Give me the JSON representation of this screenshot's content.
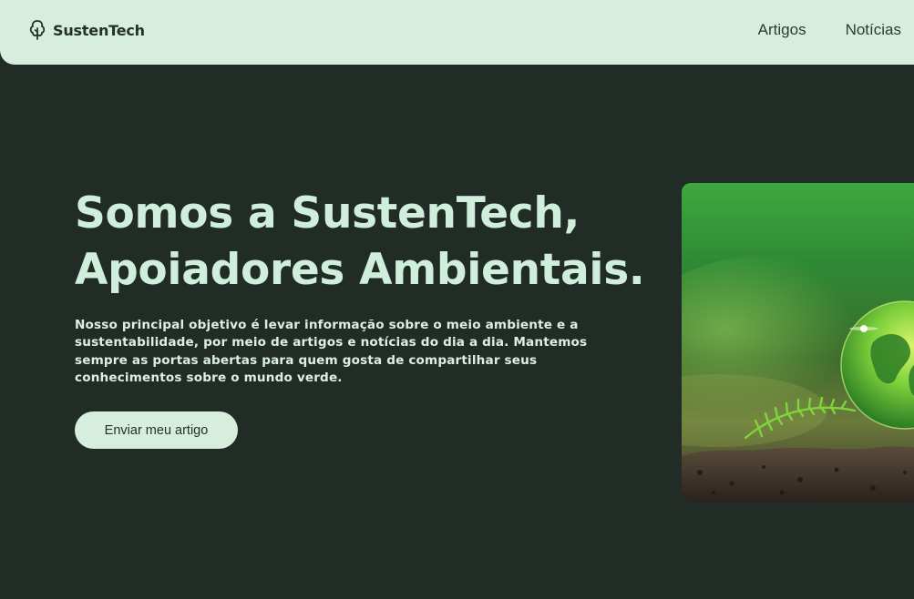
{
  "header": {
    "brand": {
      "name": "SustenTech",
      "icon": "tree-icon"
    },
    "nav": [
      {
        "label": "Artigos"
      },
      {
        "label": "Notícias"
      }
    ]
  },
  "hero": {
    "title_line1": "Somos a SustenTech,",
    "title_line2": "Apoiadores Ambientais.",
    "description": "Nosso principal objetivo é levar informação sobre o meio ambiente e a sustentabilidade, por meio de artigos e notícias do dia a dia. Mantemos sempre as portas abertas para quem gosta de compartilhar seus conhecimentos sobre o mundo verde.",
    "cta_label": "Enviar meu artigo",
    "image": {
      "icon": "globe-in-grass-image"
    }
  },
  "colors": {
    "background": "#222c26",
    "header_bg": "#d7eedf",
    "title": "#cfeedc",
    "text": "#dcefe4",
    "button_bg": "#d7eedf",
    "button_text": "#24302a"
  }
}
